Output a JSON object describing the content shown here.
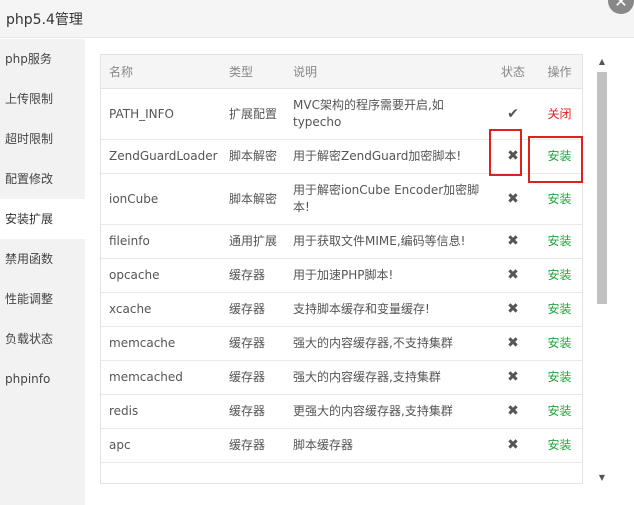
{
  "window": {
    "title": "php5.4管理",
    "close_icon": "✕"
  },
  "sidebar": {
    "items": [
      {
        "label": "php服务"
      },
      {
        "label": "上传限制"
      },
      {
        "label": "超时限制"
      },
      {
        "label": "配置修改"
      },
      {
        "label": "安装扩展",
        "active": true
      },
      {
        "label": "禁用函数"
      },
      {
        "label": "性能调整"
      },
      {
        "label": "负载状态"
      },
      {
        "label": "phpinfo"
      }
    ]
  },
  "table": {
    "headers": {
      "name": "名称",
      "type": "类型",
      "desc": "说明",
      "status": "状态",
      "op": "操作"
    },
    "rows": [
      {
        "name": "PATH_INFO",
        "type": "扩展配置",
        "desc": "MVC架构的程序需要开启,如typecho",
        "status": "✔",
        "op": "关闭"
      },
      {
        "name": "ZendGuardLoader",
        "type": "脚本解密",
        "desc": "用于解密ZendGuard加密脚本!",
        "status": "✖",
        "op": "安装"
      },
      {
        "name": "ionCube",
        "type": "脚本解密",
        "desc": "用于解密ionCube Encoder加密脚本!",
        "status": "✖",
        "op": "安装"
      },
      {
        "name": "fileinfo",
        "type": "通用扩展",
        "desc": "用于获取文件MIME,编码等信息!",
        "status": "✖",
        "op": "安装"
      },
      {
        "name": "opcache",
        "type": "缓存器",
        "desc": "用于加速PHP脚本!",
        "status": "✖",
        "op": "安装"
      },
      {
        "name": "xcache",
        "type": "缓存器",
        "desc": "支持脚本缓存和变量缓存!",
        "status": "✖",
        "op": "安装"
      },
      {
        "name": "memcache",
        "type": "缓存器",
        "desc": "强大的内容缓存器,不支持集群",
        "status": "✖",
        "op": "安装"
      },
      {
        "name": "memcached",
        "type": "缓存器",
        "desc": "强大的内容缓存器,支持集群",
        "status": "✖",
        "op": "安装"
      },
      {
        "name": "redis",
        "type": "缓存器",
        "desc": "更强大的内容缓存器,支持集群",
        "status": "✖",
        "op": "安装"
      },
      {
        "name": "apc",
        "type": "缓存器",
        "desc": "脚本缓存器",
        "status": "✖",
        "op": "安装"
      }
    ]
  },
  "scrollbar": {
    "up_icon": "▲",
    "down_icon": "▼"
  },
  "colors": {
    "install": "#20a53a",
    "close": "#e02020",
    "highlight": "#e02020"
  }
}
